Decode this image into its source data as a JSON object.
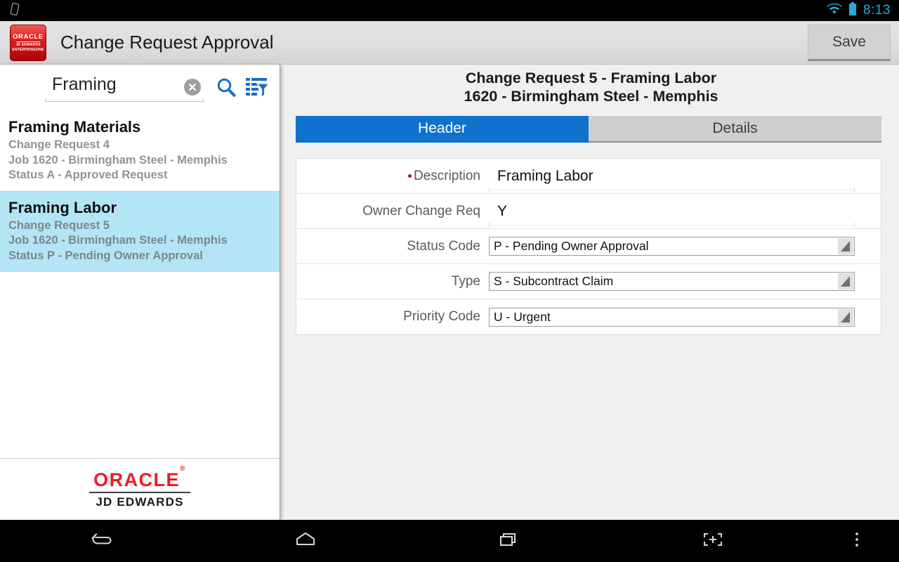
{
  "status_bar": {
    "vibrate_icon": "vibrate-icon",
    "wifi_icon": "wifi-icon",
    "battery_icon": "battery-icon",
    "clock": "8:13",
    "clock_color": "#2aa8e0"
  },
  "title_bar": {
    "app_icon": {
      "line1": "ORACLE",
      "line2": "JD EDWARDS",
      "line3": "ENTERPRISEONE"
    },
    "title": "Change Request Approval",
    "save_label": "Save"
  },
  "search": {
    "value": "Framing",
    "placeholder": "",
    "clear_icon": "clear-circle-icon",
    "search_icon": "search-icon",
    "filter_icon": "filter-list-icon"
  },
  "list": {
    "items": [
      {
        "title": "Framing Materials",
        "line1": "Change Request 4",
        "line2": "Job 1620 - Birmingham Steel - Memphis",
        "line3": "Status A - Approved Request",
        "selected": false
      },
      {
        "title": "Framing Labor",
        "line1": "Change Request 5",
        "line2": "Job 1620 - Birmingham Steel - Memphis",
        "line3": "Status P - Pending Owner Approval",
        "selected": true
      }
    ],
    "selected_color": "#b3e5f7"
  },
  "left_footer": {
    "brand": "ORACLE",
    "brand_mark": "®",
    "product": "JD EDWARDS",
    "brand_color": "#ec1c23"
  },
  "detail": {
    "heading_line1": "Change Request 5 - Framing Labor",
    "heading_line2": "1620 - Birmingham Steel - Memphis",
    "tabs": [
      {
        "label": "Header",
        "active": true
      },
      {
        "label": "Details",
        "active": false
      }
    ],
    "active_tab_color": "#0f73cd",
    "fields": [
      {
        "label": "Description",
        "required": true,
        "type": "text",
        "value": "Framing Labor"
      },
      {
        "label": "Owner Change Req",
        "required": false,
        "type": "text",
        "value": "Y"
      },
      {
        "label": "Status Code",
        "required": false,
        "type": "select",
        "value": "P - Pending Owner Approval"
      },
      {
        "label": "Type",
        "required": false,
        "type": "select",
        "value": "S - Subcontract Claim"
      },
      {
        "label": "Priority Code",
        "required": false,
        "type": "select",
        "value": "U - Urgent"
      }
    ]
  },
  "nav_bar": {
    "back_icon": "back-arrow-icon",
    "home_icon": "home-icon",
    "recents_icon": "recent-apps-icon",
    "screenshot_icon": "screenshot-icon",
    "overflow_icon": "overflow-menu-icon"
  }
}
